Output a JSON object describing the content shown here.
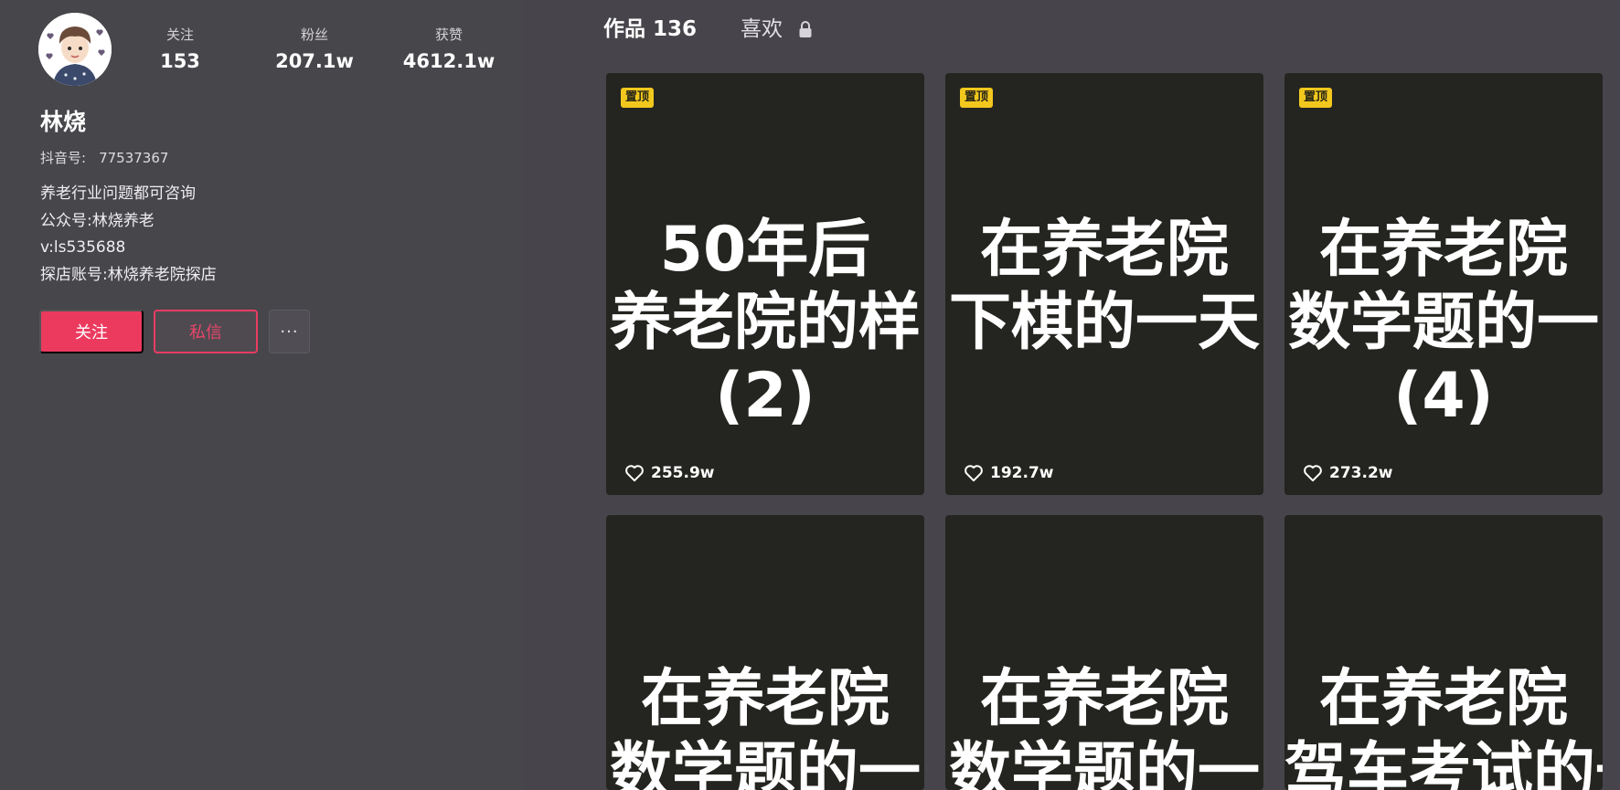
{
  "profile": {
    "avatar_icon": "cartoon-avatar",
    "stats": [
      {
        "label": "关注",
        "value": "153"
      },
      {
        "label": "粉丝",
        "value": "207.1w"
      },
      {
        "label": "获赞",
        "value": "4612.1w"
      }
    ],
    "nickname": "林烧",
    "douyin_id_label": "抖音号:",
    "douyin_id": "77537367",
    "bio": [
      "养老行业问题都可咨询",
      "公众号:林烧养老",
      "v:ls535688",
      "探店账号:林烧养老院探店"
    ],
    "buttons": {
      "follow": "关注",
      "message": "私信",
      "more": "···"
    },
    "colors": {
      "accent": "#ec3a5f",
      "badge": "#f2c81e"
    }
  },
  "works": {
    "tabs": [
      {
        "label": "作品 136"
      },
      {
        "label": "喜欢",
        "icon": "lock-icon"
      }
    ],
    "cards": [
      {
        "pinned": true,
        "badge": "置顶",
        "cover_lines": [
          "50年后",
          "养老院的样",
          "(2)"
        ],
        "likes": "255.9w"
      },
      {
        "pinned": true,
        "badge": "置顶",
        "cover_lines": [
          "在养老院",
          "下棋的一天",
          ""
        ],
        "likes": "192.7w"
      },
      {
        "pinned": true,
        "badge": "置顶",
        "cover_lines": [
          "在养老院",
          "数学题的一",
          "(4)"
        ],
        "likes": "273.2w"
      },
      {
        "pinned": false,
        "cover_lines": [
          "在养老院",
          "数学题的一"
        ]
      },
      {
        "pinned": false,
        "cover_lines": [
          "在养老院",
          "数学题的一"
        ]
      },
      {
        "pinned": false,
        "cover_lines": [
          "在养老院",
          "驾车考试的一"
        ]
      }
    ]
  }
}
